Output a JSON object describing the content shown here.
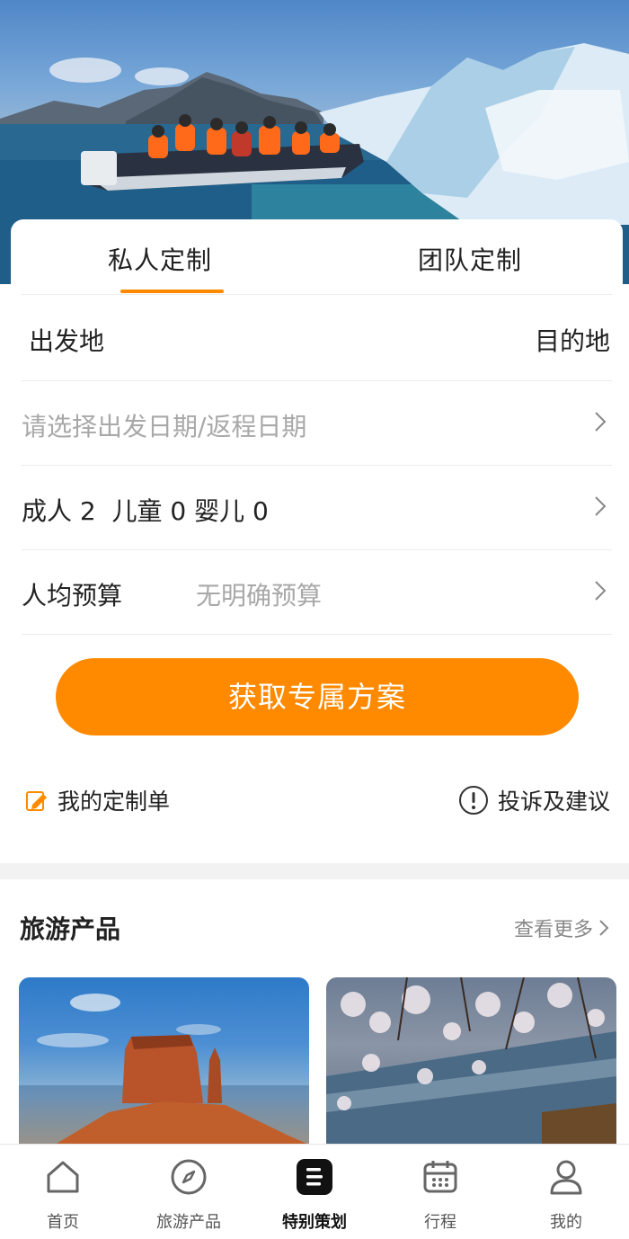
{
  "tabs": [
    "私人定制",
    "团队定制"
  ],
  "form": {
    "departure": "出发地",
    "destination": "目的地",
    "date_placeholder": "请选择出发日期/返程日期",
    "travelers": "成人 2  儿童 0 婴儿 0",
    "budget_label": "人均预算",
    "budget_placeholder": "无明确预算"
  },
  "cta_label": "获取专属方案",
  "links": {
    "my_orders": "我的定制单",
    "feedback": "投诉及建议"
  },
  "products_section": {
    "title": "旅游产品",
    "more": "查看更多"
  },
  "tabbar": [
    {
      "label": "首页",
      "icon": "home-icon"
    },
    {
      "label": "旅游产品",
      "icon": "compass-icon"
    },
    {
      "label": "特别策划",
      "icon": "special-plan-icon"
    },
    {
      "label": "行程",
      "icon": "calendar-icon"
    },
    {
      "label": "我的",
      "icon": "user-icon"
    }
  ],
  "colors": {
    "accent": "#ff8a00"
  }
}
